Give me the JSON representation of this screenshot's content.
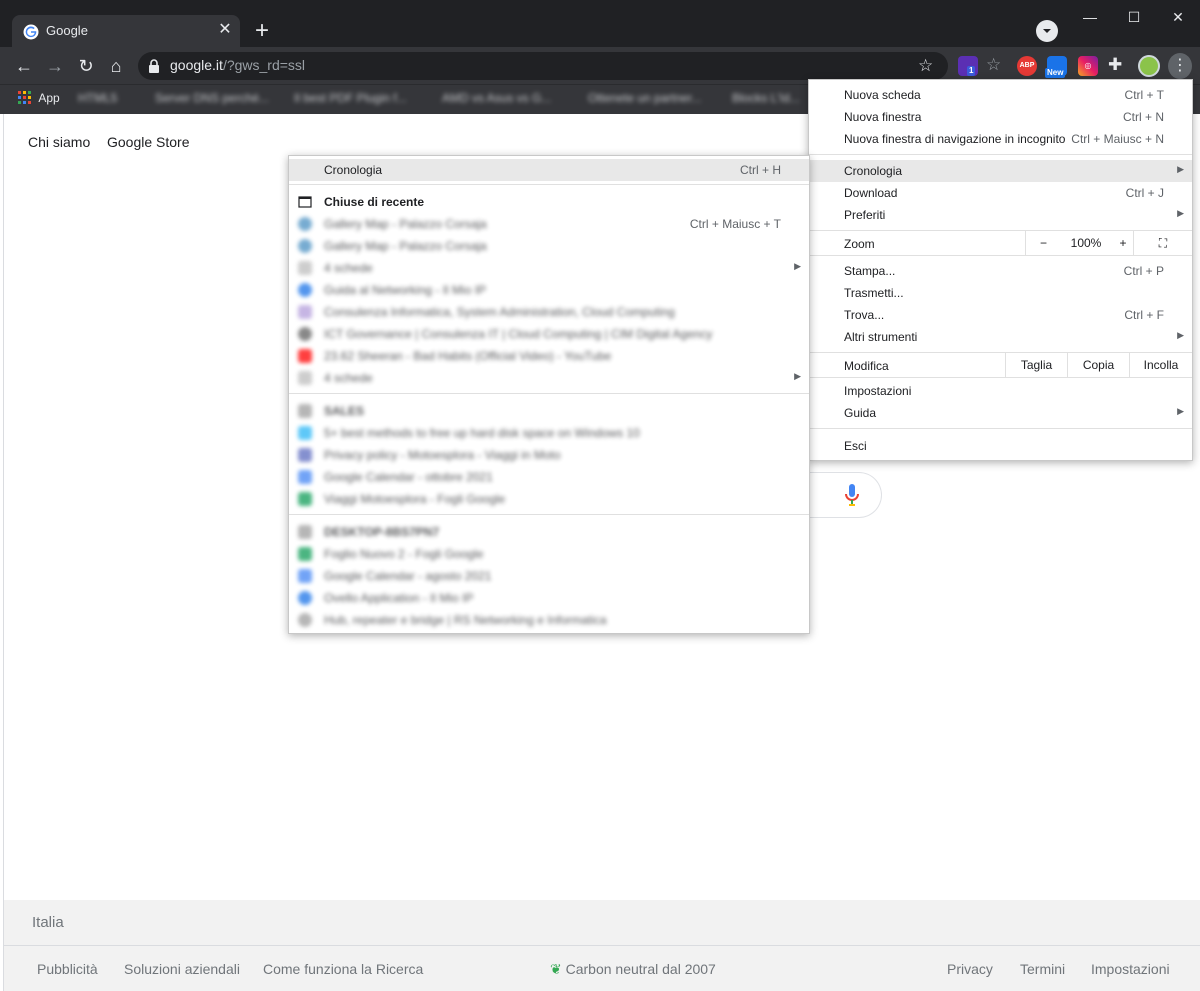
{
  "tab": {
    "title": "Google",
    "close_glyph": "✕",
    "new_tab_glyph": "+"
  },
  "window_controls": {
    "minimize": "—",
    "maximize": "☐",
    "close": "✕"
  },
  "omnibox": {
    "host": "google.it",
    "path": "/?gws_rd=ssl"
  },
  "bookmarks": {
    "apps_label": "App",
    "items": [
      "HTML5",
      "Server DNS perché...",
      "Il best PDF Plugin f...",
      "AMD vs Asus vs G...",
      "Ottenete un partner...",
      "Blocks L'Id..."
    ]
  },
  "extensions": {
    "badge_count": "1",
    "abp": "ABP",
    "new_badge": "New"
  },
  "page": {
    "header_links": [
      "Chi siamo",
      "Google Store"
    ],
    "country": "Italia",
    "footer_left": [
      "Pubblicità",
      "Soluzioni aziendali",
      "Come funziona la Ricerca"
    ],
    "footer_center": "Carbon neutral dal 2007",
    "footer_right": [
      "Privacy",
      "Termini",
      "Impostazioni"
    ]
  },
  "menu": {
    "new_tab": {
      "label": "Nuova scheda",
      "shortcut": "Ctrl + T"
    },
    "new_window": {
      "label": "Nuova finestra",
      "shortcut": "Ctrl + N"
    },
    "incognito": {
      "label": "Nuova finestra di navigazione in incognito",
      "shortcut": "Ctrl + Maiusc + N"
    },
    "history": {
      "label": "Cronologia"
    },
    "downloads": {
      "label": "Download",
      "shortcut": "Ctrl + J"
    },
    "bookmarks": {
      "label": "Preferiti"
    },
    "zoom": {
      "label": "Zoom",
      "minus": "−",
      "value": "100%",
      "plus": "+"
    },
    "print": {
      "label": "Stampa...",
      "shortcut": "Ctrl + P"
    },
    "cast": {
      "label": "Trasmetti..."
    },
    "find": {
      "label": "Trova...",
      "shortcut": "Ctrl + F"
    },
    "more_tools": {
      "label": "Altri strumenti"
    },
    "edit": {
      "label": "Modifica",
      "cut": "Taglia",
      "copy": "Copia",
      "paste": "Incolla"
    },
    "settings": {
      "label": "Impostazioni"
    },
    "help": {
      "label": "Guida"
    },
    "exit": {
      "label": "Esci"
    }
  },
  "history_submenu": {
    "header": {
      "label": "Cronologia",
      "shortcut": "Ctrl + H"
    },
    "recently_closed": "Chiuse di recente",
    "reopen_shortcut": "Ctrl + Maiusc + T",
    "recent_items": [
      "Gallery Map - Palazzo Corsaja",
      "Gallery Map - Palazzo Corsaja",
      "4 schede",
      "Guida al Networking - Il Mio IP",
      "Consulenza Informatica, System Administration, Cloud Computing",
      "ICT Governance | Consulenza IT | Cloud Computing | CIM Digital Agency",
      "23.62 Sheeran - Bad Habits (Official Video) - YouTube",
      "4 schede"
    ],
    "device1_name": "SALES",
    "device1_items": [
      "5+ best methods to free up hard disk space on Windows 10",
      "Privacy policy - Motoesplora - Viaggi in Moto",
      "Google Calendar - ottobre 2021",
      "Viaggi Motoesplora - Fogli Google"
    ],
    "device2_name": "DESKTOP-8BS7PN7",
    "device2_items": [
      "Foglio Nuovo 2 - Fogli Google",
      "Google Calendar - agosto 2021",
      "Ovello Application - Il Mio IP",
      "Hub, repeater e bridge | RS Networking e Informatica"
    ]
  }
}
